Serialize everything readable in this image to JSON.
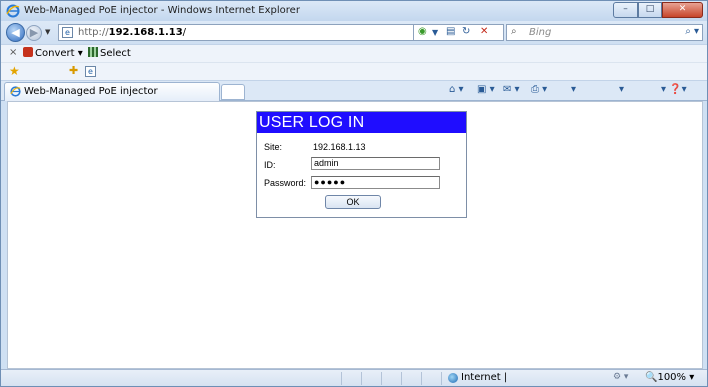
{
  "window": {
    "title": "Web-Managed PoE injector - Windows Internet Explorer",
    "minimize_glyph": "–",
    "maximize_glyph": "□",
    "close_glyph": "✕"
  },
  "address_bar": {
    "protocol": "http://",
    "host": "192.168.1.13",
    "path": "/"
  },
  "search": {
    "placeholder": "Bing"
  },
  "command_toolbar": {
    "close_glyph": "×",
    "convert_label": "Convert",
    "select_label": "Select"
  },
  "tab": {
    "title": "Web-Managed PoE injector"
  },
  "login": {
    "header": "USER LOG IN",
    "site_label": "Site:",
    "site_value": "192.168.1.13",
    "id_label": "ID:",
    "id_value": "admin",
    "password_label": "Password:",
    "password_value": "●●●●●",
    "ok_label": "OK",
    "header_color": "#1f0dff"
  },
  "status_bar": {
    "zone": "Internet |",
    "zoom": "100%"
  },
  "icons": [
    "ie-icon",
    "back-icon",
    "forward-icon",
    "refresh-icon",
    "stop-icon",
    "search-icon",
    "favorites-star-icon",
    "add-favorites-icon",
    "home-icon",
    "feeds-icon",
    "mail-icon",
    "print-icon",
    "help-icon",
    "globe-icon",
    "zoom-icon"
  ]
}
